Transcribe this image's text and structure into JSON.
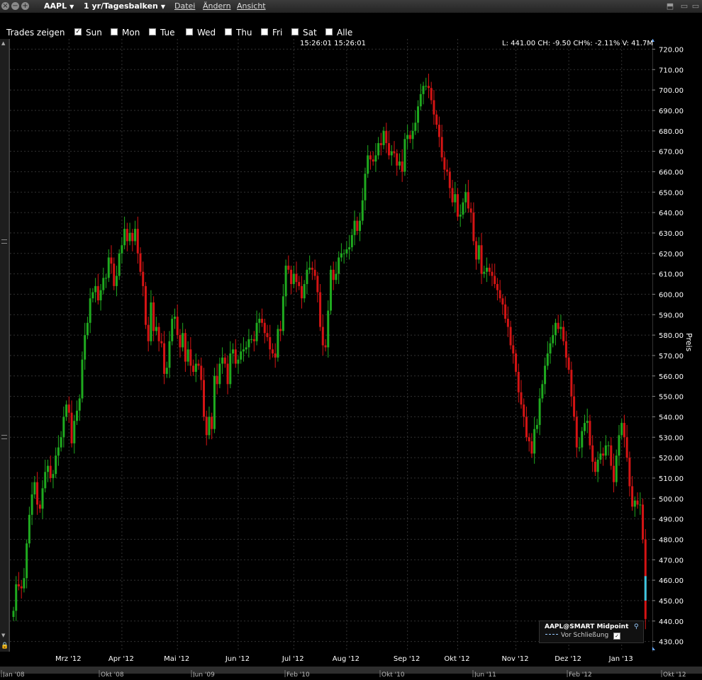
{
  "toolbar": {
    "symbol": "AAPL",
    "period": "1 yr/Tagesbalken",
    "menus": [
      "Datei",
      "Ändern",
      "Ansicht"
    ]
  },
  "trades_bar": {
    "label": "Trades zeigen",
    "days": [
      {
        "label": "Sun",
        "checked": true
      },
      {
        "label": "Mon",
        "checked": false
      },
      {
        "label": "Tue",
        "checked": false
      },
      {
        "label": "Wed",
        "checked": false
      },
      {
        "label": "Thu",
        "checked": false
      },
      {
        "label": "Fri",
        "checked": false
      },
      {
        "label": "Sat",
        "checked": false
      },
      {
        "label": "Alle",
        "checked": false
      }
    ]
  },
  "chart_header": {
    "time": "15:26:01 15:26:01",
    "quote": "L: 441.00 CH: -9.50 CH%: -2.11% V: 41.7M"
  },
  "legend": {
    "title": "AAPL@SMART Midpoint",
    "subtitle": "Vor Schließung"
  },
  "colors": {
    "up": "#1faa1f",
    "down": "#d41414",
    "current": "#39c6e0",
    "grid": "#333333",
    "axis_text": "#ffffff"
  },
  "chart_data": {
    "type": "candlestick",
    "title": "",
    "xlabel": "",
    "ylabel": "Preis",
    "ylim": [
      425,
      725
    ],
    "yticks": [
      720,
      710,
      700,
      690,
      680,
      670,
      660,
      650,
      640,
      630,
      620,
      610,
      600,
      590,
      580,
      570,
      560,
      550,
      540,
      530,
      520,
      510,
      500,
      490,
      480,
      470,
      460,
      450,
      440,
      430
    ],
    "xticks": [
      {
        "label": "Mrz '12",
        "day": 21
      },
      {
        "label": "Apr '12",
        "day": 41
      },
      {
        "label": "Mai '12",
        "day": 62
      },
      {
        "label": "Jun '12",
        "day": 85
      },
      {
        "label": "Jul '12",
        "day": 106
      },
      {
        "label": "Aug '12",
        "day": 126
      },
      {
        "label": "Sep '12",
        "day": 149
      },
      {
        "label": "Okt '12",
        "day": 168
      },
      {
        "label": "Nov '12",
        "day": 190
      },
      {
        "label": "Dez '12",
        "day": 210
      },
      {
        "label": "Jan '13",
        "day": 230
      }
    ],
    "nav_labels": [
      "Jan '08",
      "Okt '08",
      "Jun '09",
      "Feb '10",
      "Okt '10",
      "Jun '11",
      "Feb '12",
      "Okt '12"
    ],
    "closes": [
      445,
      458,
      457,
      456,
      461,
      478,
      492,
      502,
      508,
      497,
      495,
      505,
      513,
      516,
      510,
      512,
      521,
      525,
      530,
      540,
      546,
      542,
      527,
      538,
      543,
      549,
      568,
      580,
      586,
      598,
      601,
      604,
      597,
      602,
      608,
      608,
      618,
      615,
      604,
      609,
      620,
      624,
      632,
      626,
      630,
      626,
      632,
      620,
      611,
      604,
      585,
      577,
      596,
      582,
      584,
      577,
      576,
      561,
      564,
      577,
      588,
      589,
      580,
      574,
      581,
      567,
      573,
      565,
      562,
      566,
      565,
      558,
      540,
      531,
      540,
      534,
      560,
      556,
      566,
      569,
      566,
      556,
      571,
      573,
      566,
      568,
      572,
      573,
      574,
      578,
      578,
      577,
      586,
      588,
      586,
      581,
      579,
      573,
      571,
      569,
      583,
      582,
      599,
      614,
      612,
      605,
      610,
      606,
      604,
      598,
      605,
      612,
      613,
      612,
      609,
      601,
      584,
      575,
      574,
      592,
      612,
      607,
      610,
      618,
      620,
      620,
      622,
      623,
      629,
      636,
      631,
      636,
      646,
      659,
      668,
      666,
      665,
      668,
      674,
      673,
      680,
      674,
      668,
      670,
      669,
      663,
      665,
      660,
      676,
      678,
      676,
      680,
      684,
      692,
      698,
      702,
      702,
      701,
      695,
      688,
      683,
      677,
      667,
      661,
      660,
      652,
      645,
      649,
      638,
      639,
      645,
      650,
      642,
      640,
      626,
      617,
      624,
      610,
      611,
      613,
      611,
      609,
      605,
      602,
      598,
      595,
      588,
      584,
      575,
      571,
      562,
      552,
      546,
      540,
      530,
      528,
      522,
      534,
      536,
      549,
      556,
      565,
      571,
      576,
      580,
      586,
      583,
      584,
      577,
      569,
      563,
      550,
      540,
      525,
      525,
      533,
      537,
      538,
      526,
      518,
      513,
      519,
      522,
      521,
      526,
      526,
      516,
      508,
      521,
      531,
      537,
      530,
      520,
      506,
      496,
      499,
      497,
      497,
      480,
      441
    ]
  }
}
